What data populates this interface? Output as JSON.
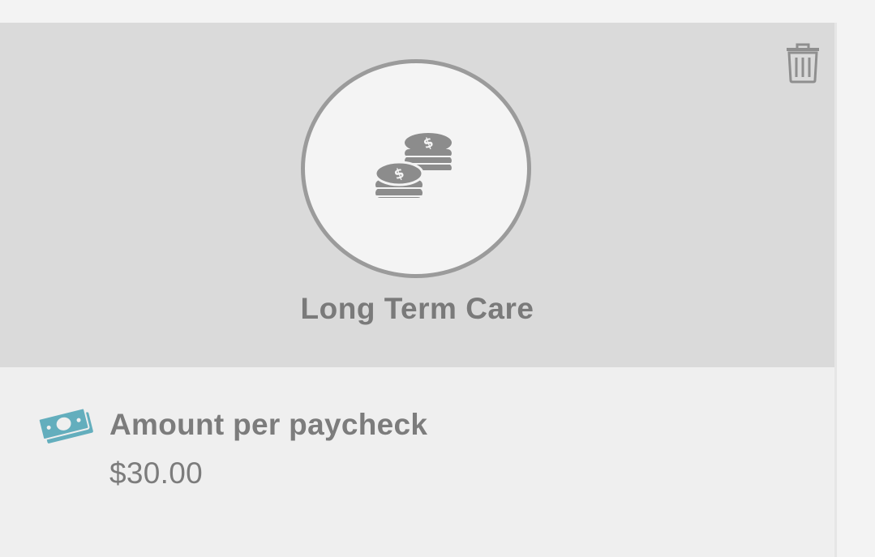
{
  "card": {
    "title": "Long Term Care",
    "category_icon": "coins-icon",
    "delete_icon": "trash-icon"
  },
  "detail": {
    "icon": "money-icon",
    "label": "Amount per paycheck",
    "value": "$30.00"
  },
  "colors": {
    "header_bg": "#dadada",
    "circle_border": "#9b9b9b",
    "text_gray": "#7a7a7a",
    "money_teal": "#63aebd"
  }
}
